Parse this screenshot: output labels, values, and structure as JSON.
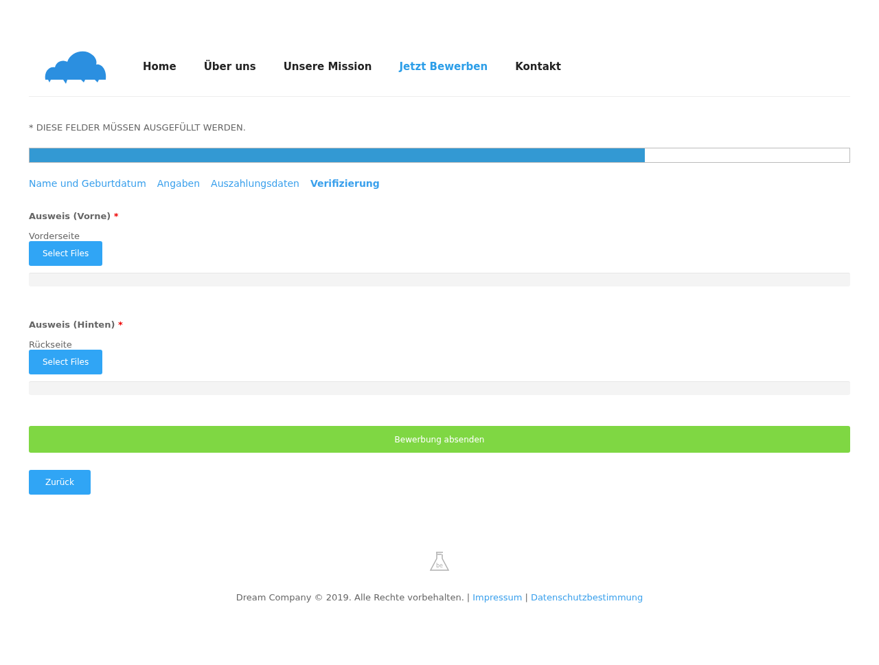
{
  "nav": [
    {
      "label": "Home",
      "selected": false
    },
    {
      "label": "Über uns",
      "selected": false
    },
    {
      "label": "Unsere Mission",
      "selected": false
    },
    {
      "label": "Jetzt Bewerben",
      "selected": true
    },
    {
      "label": "Kontakt",
      "selected": false
    }
  ],
  "required_note": "* DIESE FELDER MÜSSEN AUSGEFÜLLT WERDEN.",
  "progress": {
    "level": 0.75
  },
  "steps": [
    {
      "label": "Name und Geburtdatum",
      "selected": false
    },
    {
      "label": "Angaben",
      "selected": false
    },
    {
      "label": "Auszahlungsdaten",
      "selected": false
    },
    {
      "label": "Verifizierung",
      "selected": true
    }
  ],
  "uploads": [
    {
      "label": "Ausweis (Vorne)",
      "required_mark": "*",
      "description": "Vorderseite",
      "button": "Select Files"
    },
    {
      "label": "Ausweis (Hinten)",
      "required_mark": "*",
      "description": "Rückseite",
      "button": "Select Files"
    }
  ],
  "submit_button": "Bewerbung absenden",
  "back_button": "Zurück",
  "footer": {
    "badge_text": "be",
    "copyright": "Dream Company © 2019. Alle Rechte vorbehalten.",
    "separator_1": "|",
    "impressum": "Impressum",
    "separator_2": "|",
    "privacy": "Datenschutzbestimmung"
  }
}
